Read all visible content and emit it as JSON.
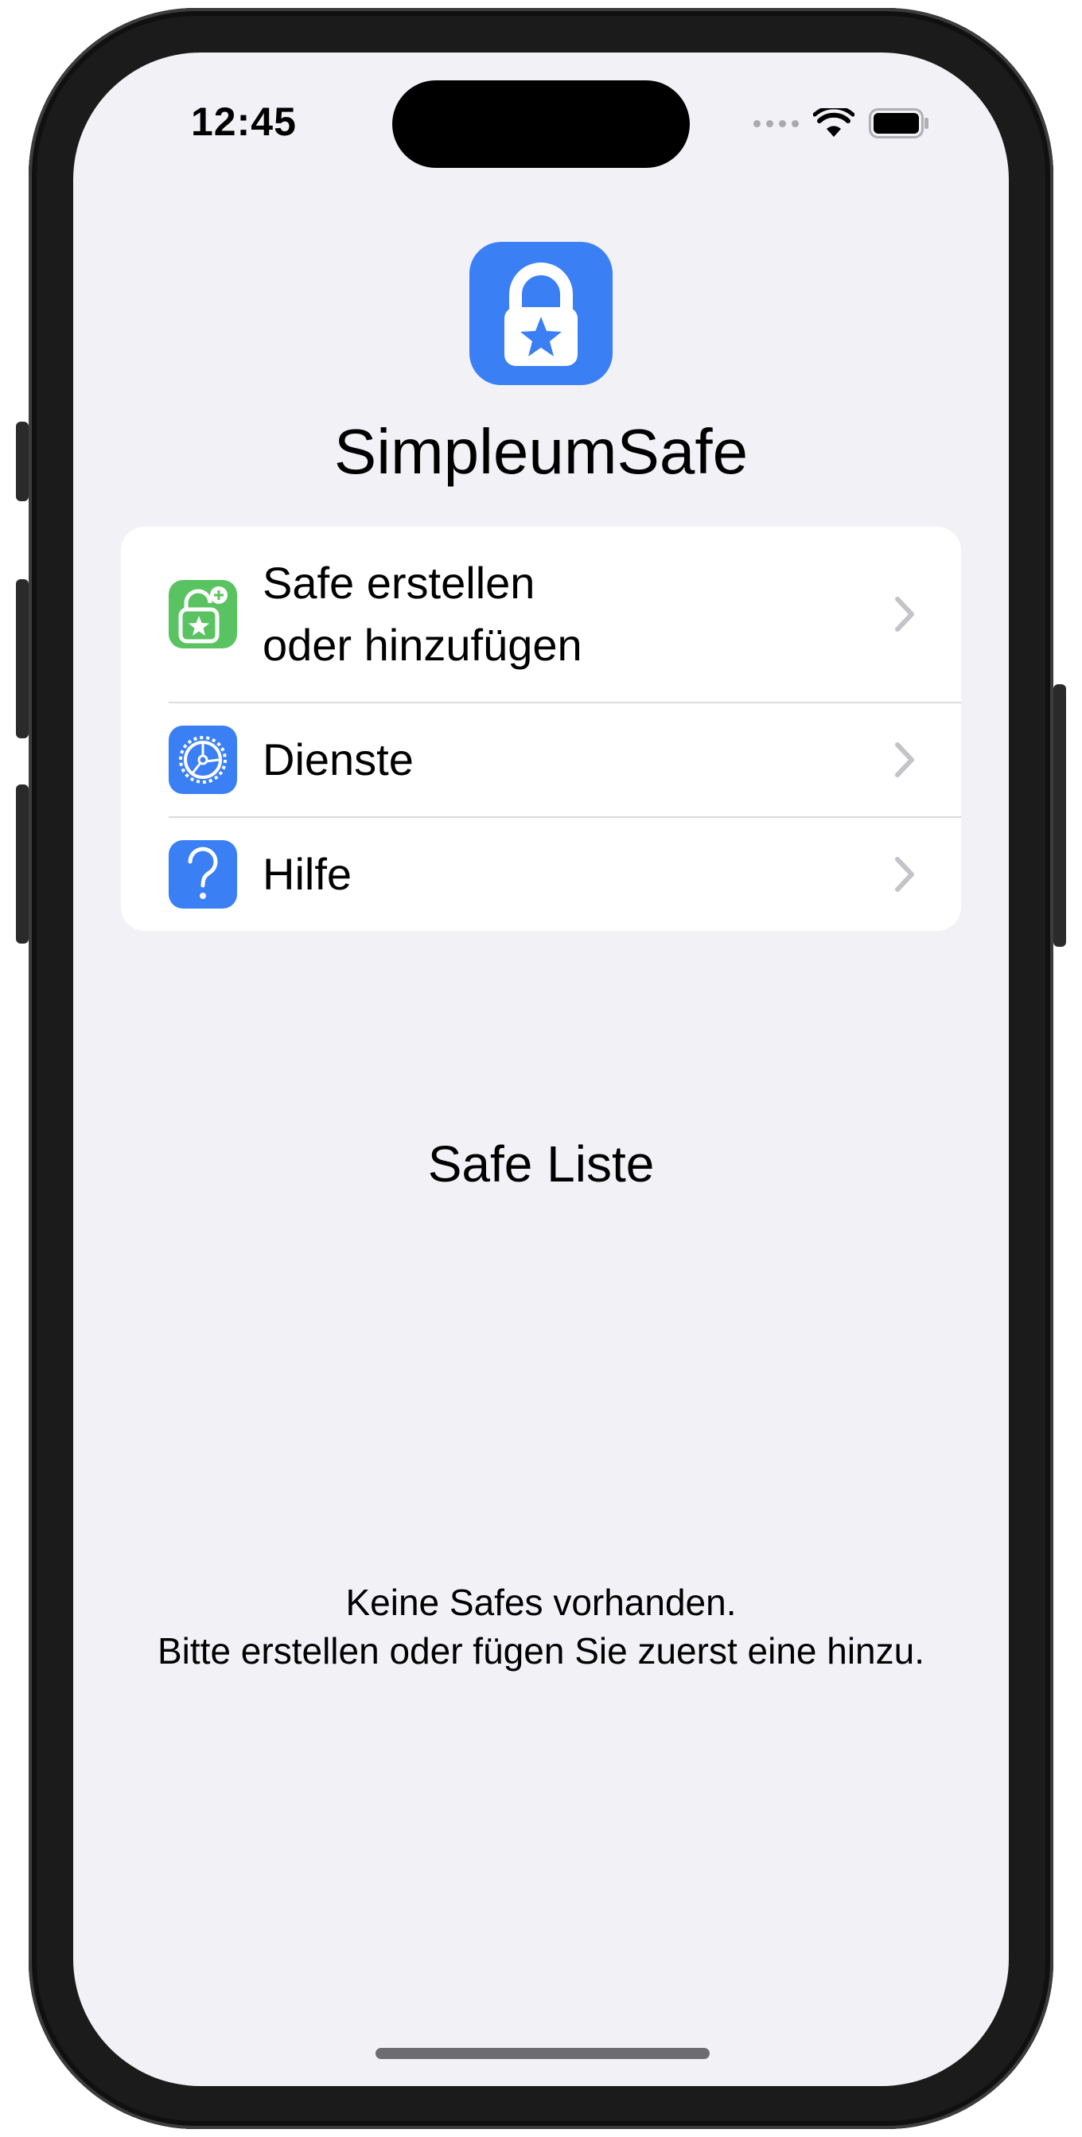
{
  "status_bar": {
    "time": "12:45",
    "icons": [
      "cellular-dots-icon",
      "wifi-icon",
      "battery-icon"
    ]
  },
  "app": {
    "icon": "lock-star-icon",
    "title": "SimpleumSafe",
    "accent_color": "#3a7ff3"
  },
  "menu": {
    "items": [
      {
        "label_line1": "Safe erstellen",
        "label_line2": "oder hinzufügen",
        "icon": "lock-add-icon",
        "icon_color": "#5ac361"
      },
      {
        "label": "Dienste",
        "icon": "services-gear-icon",
        "icon_color": "#3a7ff3"
      },
      {
        "label": "Hilfe",
        "icon": "help-question-icon",
        "icon_color": "#3a7ff3"
      }
    ]
  },
  "safe_list": {
    "title": "Safe Liste",
    "empty_line1": "Keine Safes vorhanden.",
    "empty_line2": "Bitte erstellen oder fügen Sie zuerst eine hinzu."
  }
}
